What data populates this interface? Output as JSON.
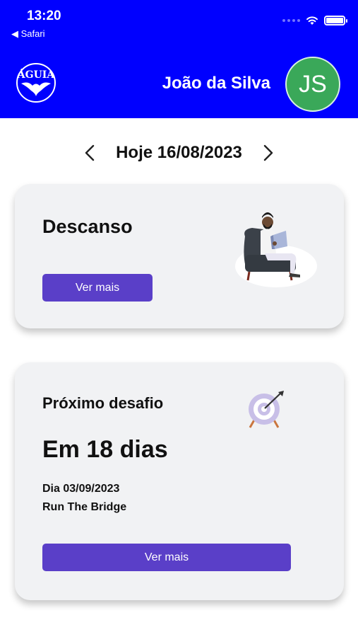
{
  "status_bar": {
    "time": "13:20",
    "back_label": "◀ Safari"
  },
  "header": {
    "user_name": "João da Silva",
    "avatar_initials": "JS",
    "bg_color": "#0000ff",
    "avatar_color": "#3aa859",
    "logo_icon": "eagle-logo"
  },
  "date_nav": {
    "date_label": "Hoje 16/08/2023",
    "prev_icon": "chevron-left-icon",
    "next_icon": "chevron-right-icon"
  },
  "rest_card": {
    "title": "Descanso",
    "button_label": "Ver mais",
    "illustration": "man-reading-in-armchair"
  },
  "challenge_card": {
    "title": "Próximo desafio",
    "countdown": "Em 18 dias",
    "date_line": "Dia 03/09/2023",
    "event_name": "Run The Bridge",
    "button_label": "Ver mais",
    "illustration": "target-with-arrow"
  },
  "colors": {
    "button": "#5a3fc8",
    "card_bg": "#f1f2f4"
  }
}
